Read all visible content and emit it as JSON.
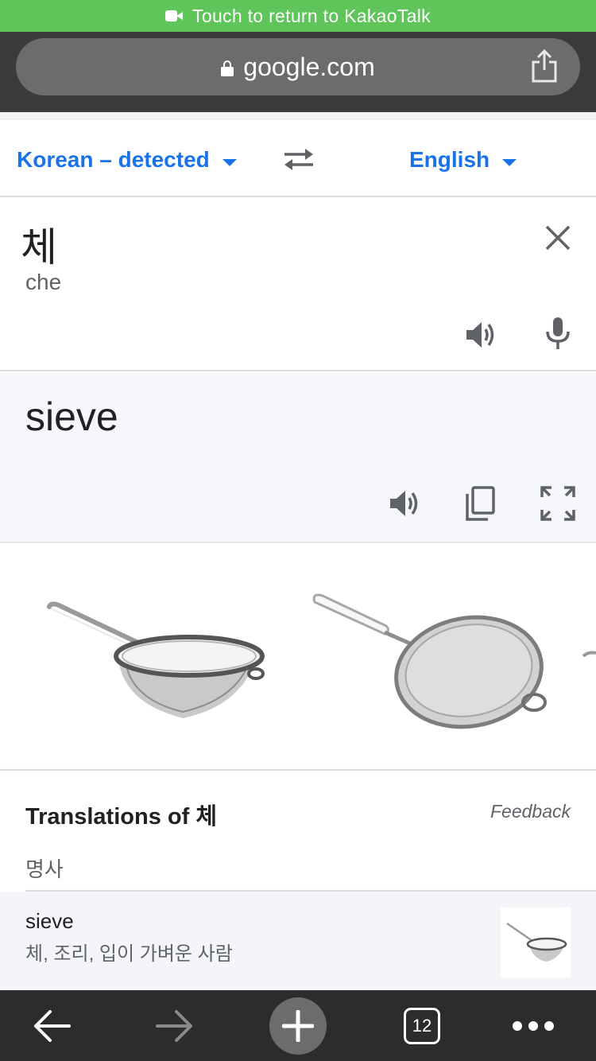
{
  "banner": {
    "text": "Touch to return to KakaoTalk",
    "icon": "video-camera-icon"
  },
  "browser": {
    "url": "google.com",
    "lock_icon": "lock-icon",
    "share_icon": "share-icon"
  },
  "languages": {
    "source": "Korean – detected",
    "target": "English",
    "swap_icon": "swap-arrows-icon"
  },
  "input": {
    "text": "체",
    "transliteration": "che",
    "clear_icon": "close-icon",
    "listen_icon": "speaker-icon",
    "mic_icon": "microphone-icon"
  },
  "output": {
    "text": "sieve",
    "listen_icon": "speaker-icon",
    "copy_icon": "copy-icon",
    "fullscreen_icon": "fullscreen-icon"
  },
  "images": [
    {
      "alt": "sieve image 1"
    },
    {
      "alt": "sieve image 2"
    }
  ],
  "translations": {
    "title": "Translations of 체",
    "feedback": "Feedback",
    "part_of_speech": "명사",
    "entries": [
      {
        "word": "sieve",
        "synonyms": "체, 조리, 입이 가벼운 사람"
      }
    ]
  },
  "toolbar": {
    "back_icon": "back-arrow-icon",
    "forward_icon": "forward-arrow-icon",
    "new_tab_icon": "plus-icon",
    "tab_count": "12",
    "menu_icon": "more-dots-icon"
  },
  "colors": {
    "banner_green": "#5fc45a",
    "link_blue": "#1a73e8",
    "toolbar_dark": "#2b2c2e"
  }
}
